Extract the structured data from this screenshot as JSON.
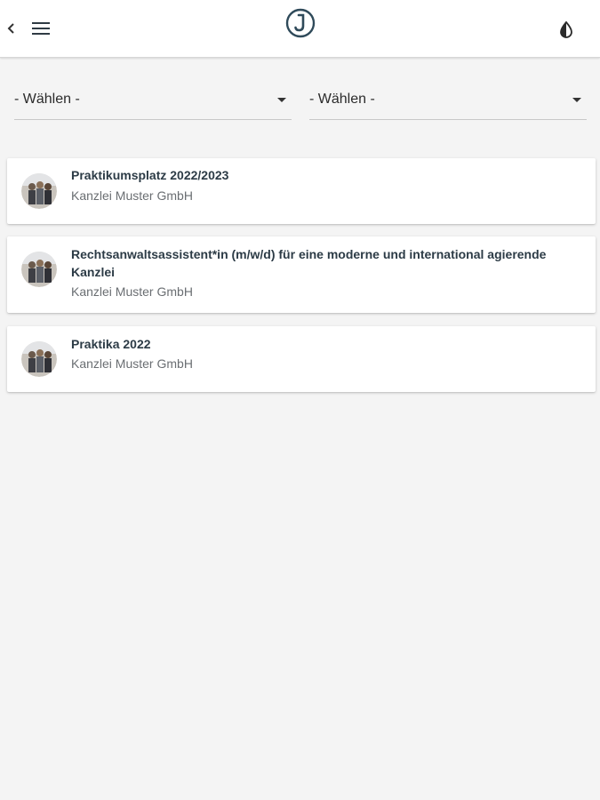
{
  "header": {
    "back_icon": "chevron-left-icon",
    "menu_icon": "hamburger-menu-icon",
    "logo_icon": "circle-j-logo-icon",
    "theme_icon": "contrast-toggle-icon",
    "logo_color": "#2f4a5a"
  },
  "filters": {
    "left": {
      "value": "- Wählen -"
    },
    "right": {
      "value": "- Wählen -"
    }
  },
  "jobs": [
    {
      "title": "Praktikumsplatz 2022/2023",
      "company": "Kanzlei Muster GmbH"
    },
    {
      "title": "Rechtsanwaltsassistent*in (m/w/d) für eine moderne und international agierende Kanzlei",
      "company": "Kanzlei Muster GmbH"
    },
    {
      "title": "Praktika 2022",
      "company": "Kanzlei Muster GmbH"
    }
  ]
}
